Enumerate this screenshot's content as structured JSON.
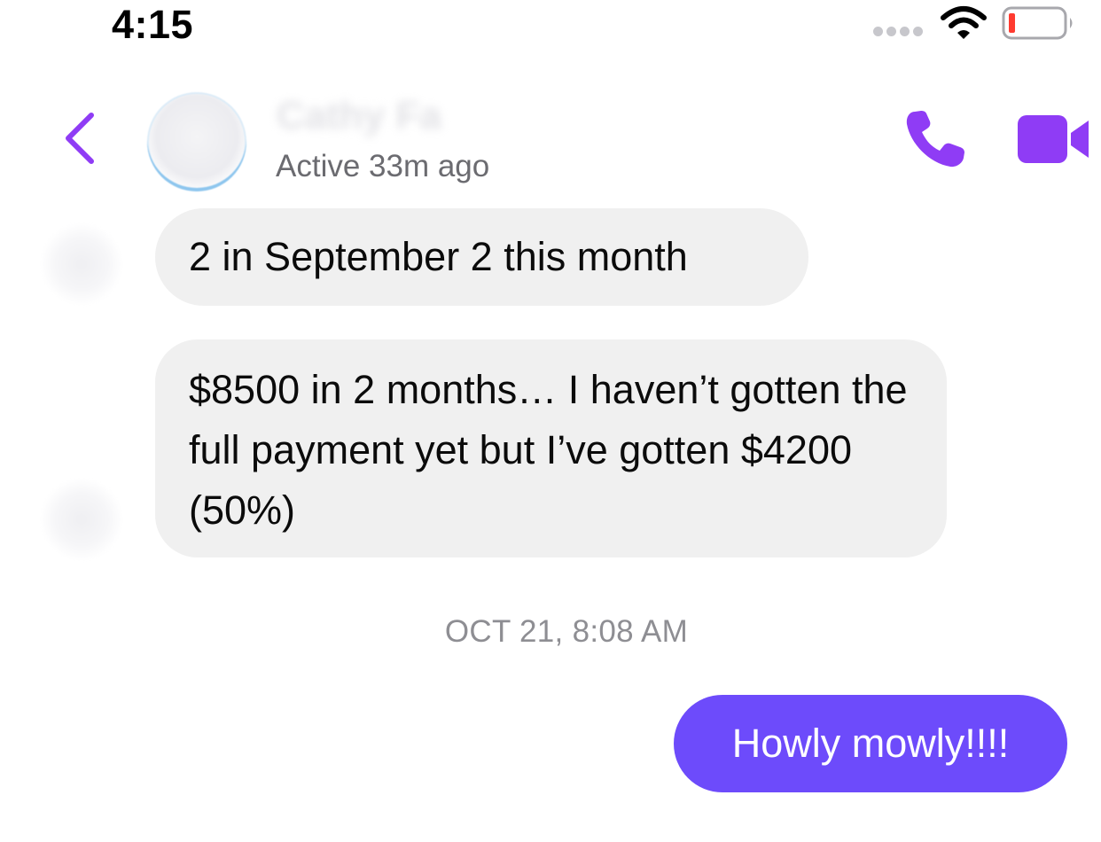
{
  "status_bar": {
    "time": "4:15"
  },
  "header": {
    "contact_name": "Cathy Fa",
    "active_status": "Active 33m ago"
  },
  "messages": [
    {
      "direction": "incoming",
      "text": "2 in September 2 this month"
    },
    {
      "direction": "incoming",
      "text": "$8500 in 2 months… I haven’t gotten the full payment yet but I’ve gotten $4200 (50%)"
    }
  ],
  "timestamp": "OCT 21, 8:08 AM",
  "outgoing_message": {
    "direction": "outgoing",
    "text": "Howly mowly!!!!"
  },
  "colors": {
    "accent": "#8f3cf5",
    "outgoing_bubble": "#6d4bfb",
    "incoming_bubble": "#f0f0f0",
    "battery_low": "#ff3b30"
  },
  "icons": {
    "back": "chevron-left-icon",
    "call": "phone-icon",
    "video": "video-camera-icon",
    "wifi": "wifi-icon",
    "battery": "battery-icon"
  }
}
